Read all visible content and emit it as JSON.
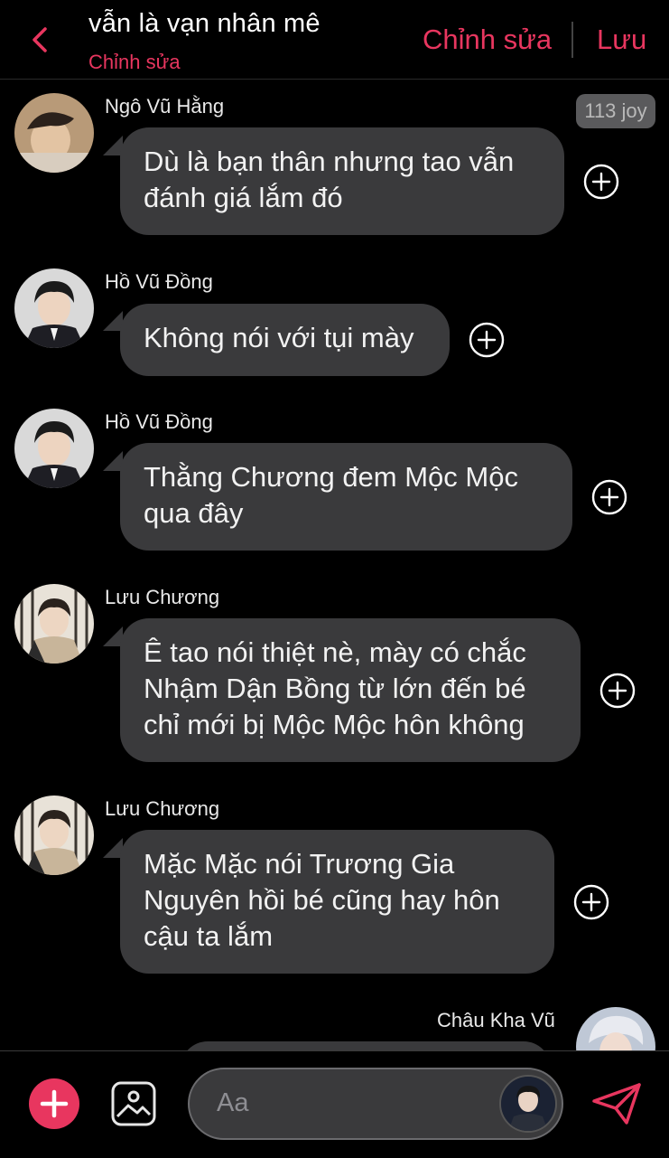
{
  "header": {
    "title": "vẫn là vạn nhân mê",
    "subtitle": "Chỉnh sửa",
    "edit_label": "Chỉnh sửa",
    "save_label": "Lưu"
  },
  "badge": "113 joy",
  "messages": [
    {
      "sender": "Ngô Vũ Hằng",
      "lines": [
        "Dù là bạn thân nhưng tao vẫn",
        "đánh giá lắm đó"
      ]
    },
    {
      "sender": "Hồ Vũ Đồng",
      "lines": [
        "Không nói với tụi mày"
      ]
    },
    {
      "sender": "Hồ Vũ Đồng",
      "lines": [
        "Thằng Chương đem Mộc Mộc",
        "qua đây"
      ]
    },
    {
      "sender": "Lưu Chương",
      "lines": [
        "Ê tao nói thiệt nè, mày có chắc",
        "Nhậm Dận Bồng từ lớn đến bé",
        "chỉ mới bị Mộc Mộc hôn không"
      ]
    },
    {
      "sender": "Lưu Chương",
      "lines": [
        "Mặc Mặc nói Trương Gia",
        "Nguyên hồi bé cũng hay hôn",
        "cậu ta lắm"
      ]
    },
    {
      "sender": "Châu Kha Vũ",
      "lines": []
    }
  ],
  "composer": {
    "placeholder": "Aa"
  },
  "icons": {
    "back": "chevron-left-icon",
    "add": "plus-icon",
    "image": "image-icon",
    "send": "send-icon",
    "reaction": "plus-circle-icon"
  },
  "colors": {
    "accent": "#e8365f",
    "bubble": "#3a3a3c",
    "background": "#000000"
  }
}
